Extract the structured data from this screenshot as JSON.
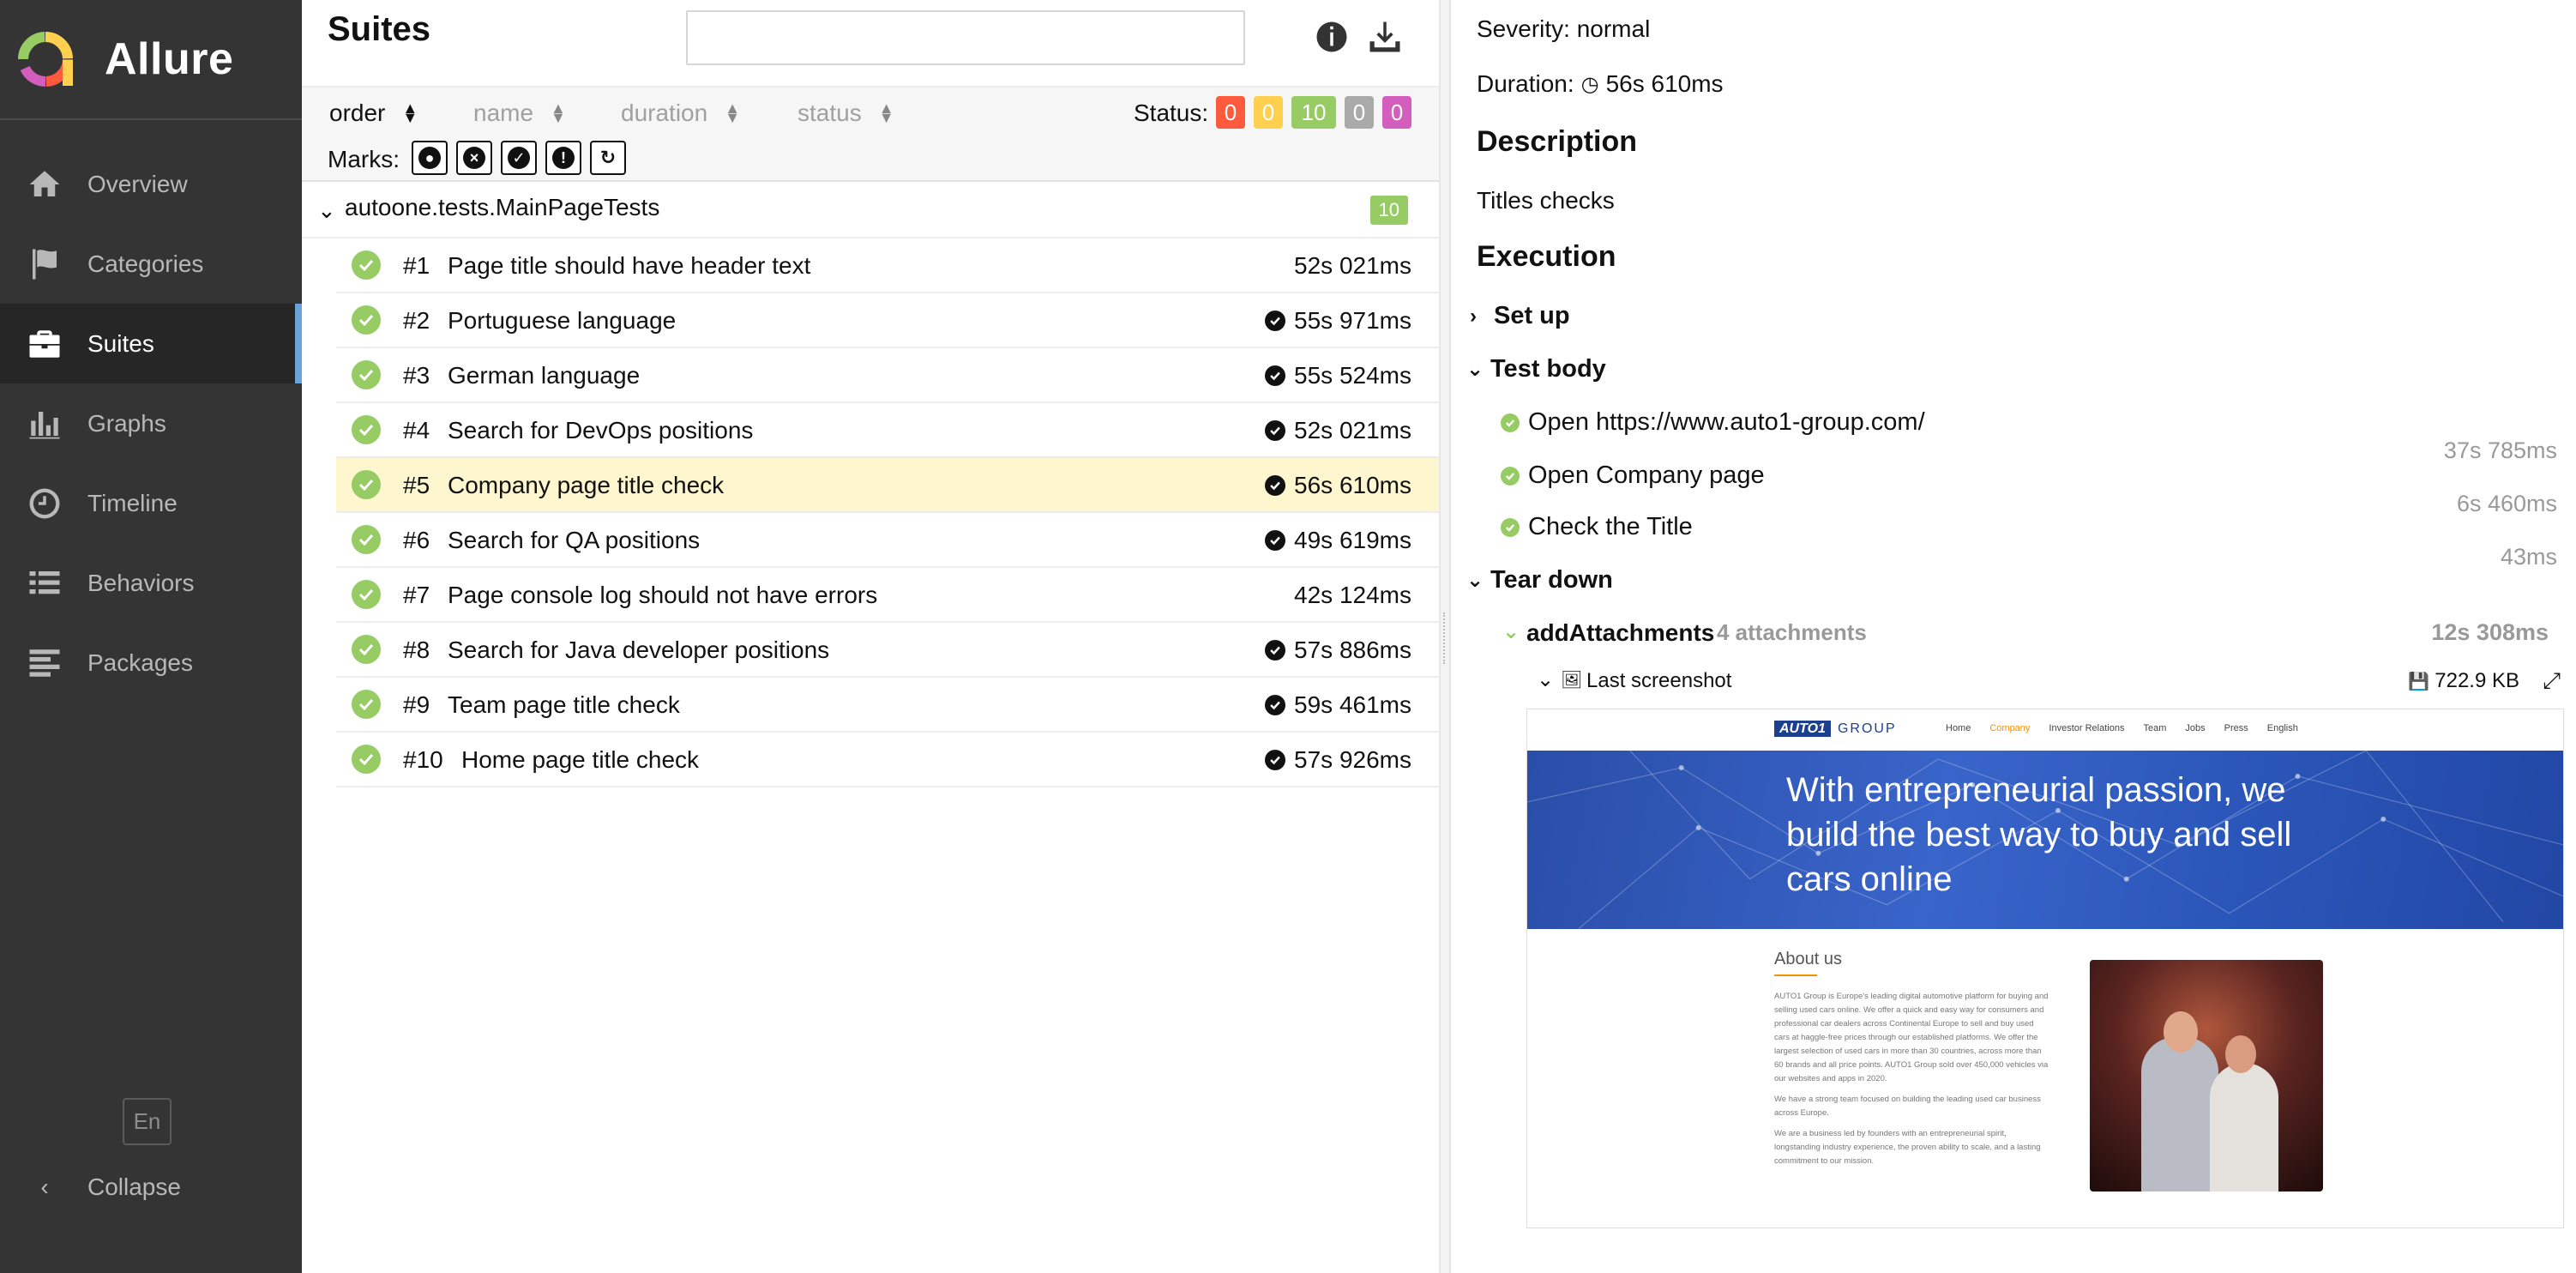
{
  "app": {
    "name": "Allure"
  },
  "sidebar": {
    "items": [
      {
        "label": "Overview",
        "icon": "home-icon"
      },
      {
        "label": "Categories",
        "icon": "flag-icon"
      },
      {
        "label": "Suites",
        "icon": "briefcase-icon",
        "active": true
      },
      {
        "label": "Graphs",
        "icon": "bar-chart-icon"
      },
      {
        "label": "Timeline",
        "icon": "clock-icon"
      },
      {
        "label": "Behaviors",
        "icon": "list-icon"
      },
      {
        "label": "Packages",
        "icon": "align-left-icon"
      }
    ],
    "language": "En",
    "collapse": "Collapse"
  },
  "suites": {
    "title": "Suites",
    "search_placeholder": "",
    "sort": {
      "order": "order",
      "name": "name",
      "duration": "duration",
      "status": "status"
    },
    "status_label": "Status:",
    "status_counts": [
      {
        "value": "0",
        "color": "#fd5a3e"
      },
      {
        "value": "0",
        "color": "#ffd050"
      },
      {
        "value": "10",
        "color": "#97cc64"
      },
      {
        "value": "0",
        "color": "#aaaaaa"
      },
      {
        "value": "0",
        "color": "#d35ebe"
      }
    ],
    "marks_label": "Marks:",
    "group": {
      "name": "autoone.tests.MainPageTests",
      "count": "10"
    },
    "tests": [
      {
        "num": "#1",
        "name": "Page title should have header text",
        "duration": "52s 021ms",
        "check": false
      },
      {
        "num": "#2",
        "name": "Portuguese language",
        "duration": "55s 971ms",
        "check": true
      },
      {
        "num": "#3",
        "name": "German language",
        "duration": "55s 524ms",
        "check": true
      },
      {
        "num": "#4",
        "name": "Search for DevOps positions",
        "duration": "52s 021ms",
        "check": true
      },
      {
        "num": "#5",
        "name": "Company page title check",
        "duration": "56s 610ms",
        "check": true,
        "selected": true
      },
      {
        "num": "#6",
        "name": "Search for QA positions",
        "duration": "49s 619ms",
        "check": true
      },
      {
        "num": "#7",
        "name": "Page console log should not have errors",
        "duration": "42s 124ms",
        "check": false
      },
      {
        "num": "#8",
        "name": "Search for Java developer positions",
        "duration": "57s 886ms",
        "check": true
      },
      {
        "num": "#9",
        "name": "Team page title check",
        "duration": "59s 461ms",
        "check": true
      },
      {
        "num": "#10",
        "name": "Home page title check",
        "duration": "57s 926ms",
        "check": true
      }
    ]
  },
  "detail": {
    "severity": "Severity: normal",
    "duration_label": "Duration:",
    "duration_value": "56s 610ms",
    "description_title": "Description",
    "description_text": "Titles checks",
    "execution_title": "Execution",
    "setup": "Set up",
    "test_body": "Test body",
    "steps": [
      {
        "name": "Open https://www.auto1-group.com/",
        "time": "37s 785ms"
      },
      {
        "name": "Open Company page",
        "time": "6s 460ms"
      },
      {
        "name": "Check the Title",
        "time": "43ms"
      }
    ],
    "teardown": "Tear down",
    "attachment_step": {
      "name": "addAttachments",
      "count": "4 attachments",
      "time": "12s 308ms"
    },
    "screenshot": {
      "name": "Last screenshot",
      "size": "722.9 KB"
    }
  },
  "embedded": {
    "logo_left": "AUTO1",
    "logo_right": "GROUP",
    "menu": [
      "Home",
      "Company",
      "Investor Relations",
      "Team",
      "Jobs",
      "Press",
      "English"
    ],
    "hero": "With entrepreneurial passion, we build the best way to buy and sell cars online",
    "about_title": "About us",
    "paragraphs": [
      "AUTO1 Group is Europe's leading digital automotive platform for buying and selling used cars online. We offer a quick and easy way for consumers and professional car dealers across Continental Europe to sell and buy used cars at haggle-free prices through our established platforms. We offer the largest selection of used cars in more than 30 countries, across more than 60 brands and all price points. AUTO1 Group sold over 450,000 vehicles via our websites and apps in 2020.",
      "We have a strong team focused on building the leading used car business across Europe.",
      "We are a business led by founders with an entrepreneurial spirit, longstanding industry experience, the proven ability to scale, and a lasting commitment to our mission."
    ]
  }
}
